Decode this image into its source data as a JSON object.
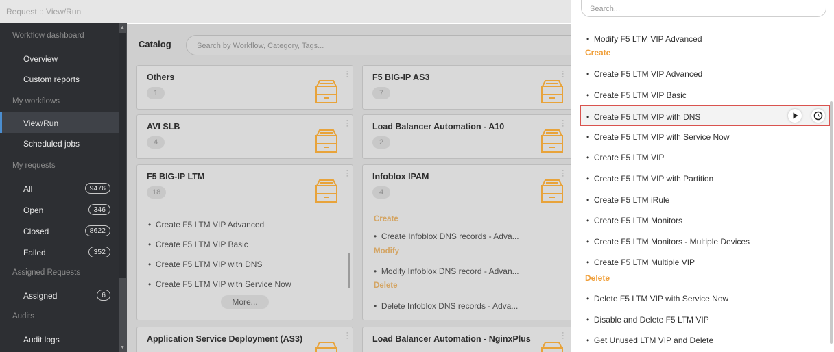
{
  "topbar": {
    "title": "Request :: View/Run"
  },
  "sidebar": {
    "sections": [
      {
        "header": "Workflow dashboard",
        "items": [
          {
            "label": "Overview"
          },
          {
            "label": "Custom reports"
          }
        ]
      },
      {
        "header": "My workflows",
        "items": [
          {
            "label": "View/Run",
            "active": true
          },
          {
            "label": "Scheduled jobs"
          }
        ]
      },
      {
        "header": "My requests",
        "items": [
          {
            "label": "All",
            "badge": "9476"
          },
          {
            "label": "Open",
            "badge": "346"
          },
          {
            "label": "Closed",
            "badge": "8622"
          },
          {
            "label": "Failed",
            "badge": "352"
          }
        ]
      },
      {
        "header": "Assigned Requests",
        "items": [
          {
            "label": "Assigned",
            "badge": "6"
          }
        ]
      },
      {
        "header": "Audits",
        "items": [
          {
            "label": "Audit logs"
          }
        ]
      }
    ]
  },
  "catalog": {
    "title": "Catalog",
    "search_placeholder": "Search by Workflow, Category, Tags...",
    "more_label": "More...",
    "cards": [
      {
        "title": "Others",
        "count": "1"
      },
      {
        "title": "F5 BIG-IP AS3",
        "count": "7"
      },
      {
        "title": "AVI SLB",
        "count": "4"
      },
      {
        "title": "Load Balancer Automation - A10",
        "count": "2"
      },
      {
        "title": "F5 BIG-IP LTM",
        "count": "18",
        "items": [
          "Create F5 LTM VIP Advanced",
          "Create F5 LTM VIP Basic",
          "Create F5 LTM VIP with DNS",
          "Create F5 LTM VIP with Service Now"
        ]
      },
      {
        "title": "Infoblox IPAM",
        "count": "4",
        "sections": [
          {
            "name": "Create",
            "items": [
              "Create Infoblox DNS records - Adva..."
            ]
          },
          {
            "name": "Modify",
            "items": [
              "Modify Infoblox DNS record - Advan..."
            ]
          },
          {
            "name": "Delete",
            "items": [
              "Delete Infoblox DNS records - Adva..."
            ]
          }
        ]
      },
      {
        "title": "Application Service Deployment (AS3)"
      },
      {
        "title": "Load Balancer Automation - NginxPlus"
      }
    ]
  },
  "panel": {
    "search_placeholder": "Search...",
    "top_item": "Modify F5 LTM VIP Advanced",
    "create_header": "Create",
    "create_items": [
      "Create F5 LTM VIP Advanced",
      "Create F5 LTM VIP Basic",
      "Create F5 LTM VIP with DNS",
      "Create F5 LTM VIP with Service Now",
      "Create F5 LTM VIP",
      "Create F5 LTM VIP with Partition",
      "Create F5 LTM iRule",
      "Create F5 LTM Monitors",
      "Create F5 LTM Monitors - Multiple Devices",
      "Create F5 LTM Multiple VIP"
    ],
    "delete_header": "Delete",
    "delete_items": [
      "Delete F5 LTM VIP with Service Now",
      "Disable and Delete F5 LTM VIP",
      "Get Unused LTM VIP and Delete"
    ],
    "highlighted_item": "Create F5 LTM VIP with DNS",
    "icons": {
      "run": "play-icon",
      "schedule": "clock-icon"
    },
    "colors": {
      "section": "#f0a03c",
      "highlight_border": "#d9534f",
      "drawer": "#e8a33a"
    }
  }
}
